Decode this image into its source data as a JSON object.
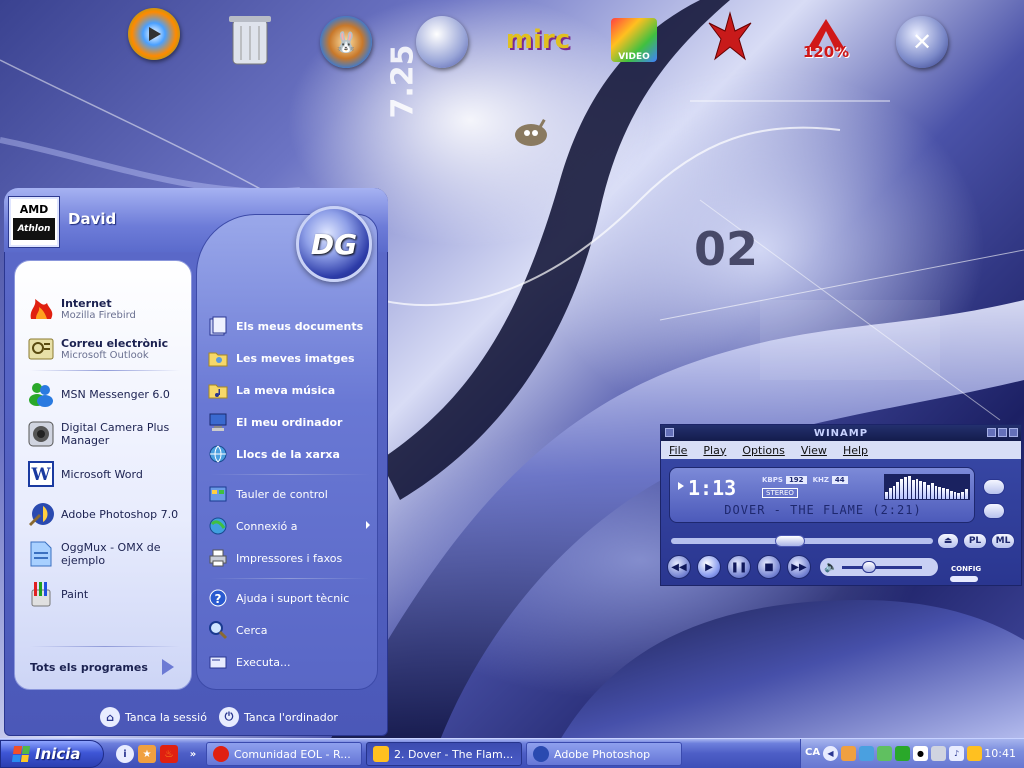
{
  "wallpaper": {
    "text_725": "7.25",
    "text_02": "02",
    "accent": "#5a68c8"
  },
  "desktop_icons": [
    {
      "name": "windows-media-player-icon",
      "color": "#ff8a00"
    },
    {
      "name": "recycle-bin-icon",
      "color": "#c0c4d0"
    },
    {
      "name": "emule-icon",
      "color": "#2e7be0"
    },
    {
      "name": "messenger-globe-icon",
      "color": "#9aa6d8"
    },
    {
      "name": "mirc-icon",
      "color": "#7a2a90"
    },
    {
      "name": "video-icon",
      "color": "#e0b010"
    },
    {
      "name": "quake-icon",
      "color": "#c81a1a"
    },
    {
      "name": "alcohol-120-icon",
      "label": "120%",
      "color": "#d01818"
    },
    {
      "name": "nero-icon",
      "color": "#7a88c8"
    }
  ],
  "start_menu": {
    "user": {
      "name": "David",
      "avatar_brand": "AMD",
      "avatar_product": "Athlon"
    },
    "pinned": [
      {
        "title": "Internet",
        "subtitle": "Mozilla Firebird",
        "icon": "firebird-icon"
      },
      {
        "title": "Correu electrònic",
        "subtitle": "Microsoft Outlook",
        "icon": "outlook-icon"
      }
    ],
    "recent": [
      {
        "title": "MSN Messenger 6.0",
        "icon": "msn-messenger-icon"
      },
      {
        "title": "Digital Camera Plus",
        "title2": "Manager",
        "icon": "camera-icon"
      },
      {
        "title": "Microsoft Word",
        "icon": "word-icon"
      },
      {
        "title": "Adobe Photoshop 7.0",
        "icon": "photoshop-icon"
      },
      {
        "title": "OggMux - OMX de",
        "title2": "ejemplo",
        "icon": "oggmux-icon"
      },
      {
        "title": "Paint",
        "icon": "paint-icon"
      }
    ],
    "all_programs": "Tots els  programes",
    "places": [
      {
        "label": "Els meus documents",
        "icon": "documents-icon"
      },
      {
        "label": "Les meves imatges",
        "icon": "pictures-icon"
      },
      {
        "label": "La meva música",
        "icon": "music-icon"
      },
      {
        "label": "El meu ordinador",
        "icon": "computer-icon"
      },
      {
        "label": "Llocs de la xarxa",
        "icon": "network-icon"
      }
    ],
    "system": [
      {
        "label": "Tauler de control",
        "icon": "control-panel-icon"
      },
      {
        "label": "Connexió a",
        "icon": "connect-icon"
      },
      {
        "label": "Impressores i faxos",
        "icon": "printers-icon"
      }
    ],
    "help": [
      {
        "label": "Ajuda i suport tècnic",
        "icon": "help-icon"
      },
      {
        "label": "Cerca",
        "icon": "search-icon"
      },
      {
        "label": "Executa...",
        "icon": "run-icon"
      }
    ],
    "logoff": "Tanca la sessió",
    "shutdown": "Tanca l'ordinador"
  },
  "winamp": {
    "title": "WINAMP",
    "menu": [
      "File",
      "Play",
      "Options",
      "View",
      "Help"
    ],
    "time": "1:13",
    "kbps_label": "KBPS",
    "kbps": "192",
    "khz_label": "KHZ",
    "khz": "44",
    "stereo": "STEREO",
    "song": "DOVER - THE FLAME (2:21)",
    "seek_fraction": 0.45,
    "volume_fraction": 0.3,
    "pl": "PL",
    "ml": "ML",
    "config": "CONFIG"
  },
  "taskbar": {
    "start_label": "Inicia",
    "tasks": [
      {
        "label": "Comunidad EOL - R...",
        "icon": "firebird-icon",
        "active": false
      },
      {
        "label": "2. Dover - The Flam...",
        "icon": "winamp-icon",
        "active": true
      },
      {
        "label": "Adobe Photoshop",
        "icon": "photoshop-icon",
        "active": false
      }
    ],
    "language": "CA",
    "clock": "10:41"
  }
}
